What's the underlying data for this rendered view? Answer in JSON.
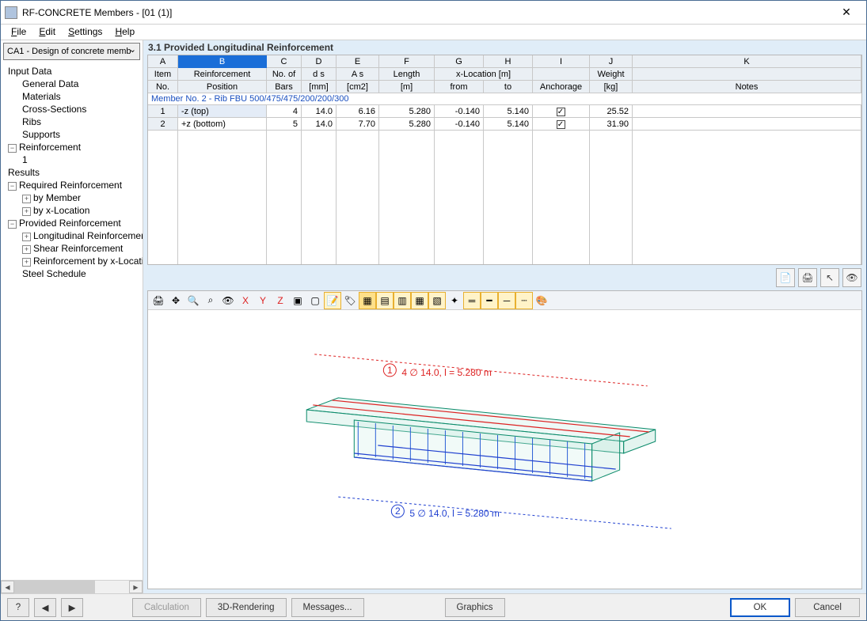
{
  "title": "RF-CONCRETE Members - [01 (1)]",
  "menus": {
    "file": "File",
    "edit": "Edit",
    "settings": "Settings",
    "help": "Help"
  },
  "combo": "CA1 - Design of concrete memb",
  "tree": {
    "input": "Input Data",
    "general": "General Data",
    "materials": "Materials",
    "xsections": "Cross-Sections",
    "ribs": "Ribs",
    "supports": "Supports",
    "reinforcement": "Reinforcement",
    "r1": "1",
    "results": "Results",
    "reqr": "Required Reinforcement",
    "bymember": "by Member",
    "byxloc": "by x-Location",
    "provr": "Provided Reinforcement",
    "long": "Longitudinal Reinforcement",
    "shear": "Shear Reinforcement",
    "rbyxloc": "Reinforcement by x-Location",
    "steel": "Steel Schedule"
  },
  "panel_title": "3.1 Provided Longitudinal Reinforcement",
  "columns": {
    "A": "A",
    "B": "B",
    "C": "C",
    "D": "D",
    "E": "E",
    "F": "F",
    "G": "G",
    "H": "H",
    "I": "I",
    "J": "J",
    "K": "K",
    "r2A": "Item",
    "r2Ab": "No.",
    "r2B": "Reinforcement",
    "r2Bb": "Position",
    "r2C": "No. of",
    "r2Cb": "Bars",
    "r2D": "d s",
    "r2Db": "[mm]",
    "r2E": "A s",
    "r2Eb": "[cm2]",
    "r2F": "Length",
    "r2Fb": "[m]",
    "r2GH": "x-Location [m]",
    "r2G": "from",
    "r2H": "to",
    "r2I": "Anchorage",
    "r2J": "Weight",
    "r2Jb": "[kg]",
    "r2K": "Notes"
  },
  "member_row": "Member No. 2  -  Rib FBU 500/475/475/200/200/300",
  "rows": [
    {
      "item": "1",
      "pos": "-z (top)",
      "bars": "4",
      "ds": "14.0",
      "as": "6.16",
      "len": "5.280",
      "from": "-0.140",
      "to": "5.140",
      "anchor": true,
      "wt": "25.52"
    },
    {
      "item": "2",
      "pos": "+z (bottom)",
      "bars": "5",
      "ds": "14.0",
      "as": "7.70",
      "len": "5.280",
      "from": "-0.140",
      "to": "5.140",
      "anchor": true,
      "wt": "31.90"
    }
  ],
  "render": {
    "label1_num": "1",
    "label1": "4 ∅ 14.0, l = 5.280 m",
    "label2_num": "2",
    "label2": "5 ∅ 14.0, l = 5.280 m"
  },
  "buttons": {
    "calc": "Calculation",
    "render3d": "3D-Rendering",
    "messages": "Messages...",
    "graphics": "Graphics",
    "ok": "OK",
    "cancel": "Cancel"
  }
}
